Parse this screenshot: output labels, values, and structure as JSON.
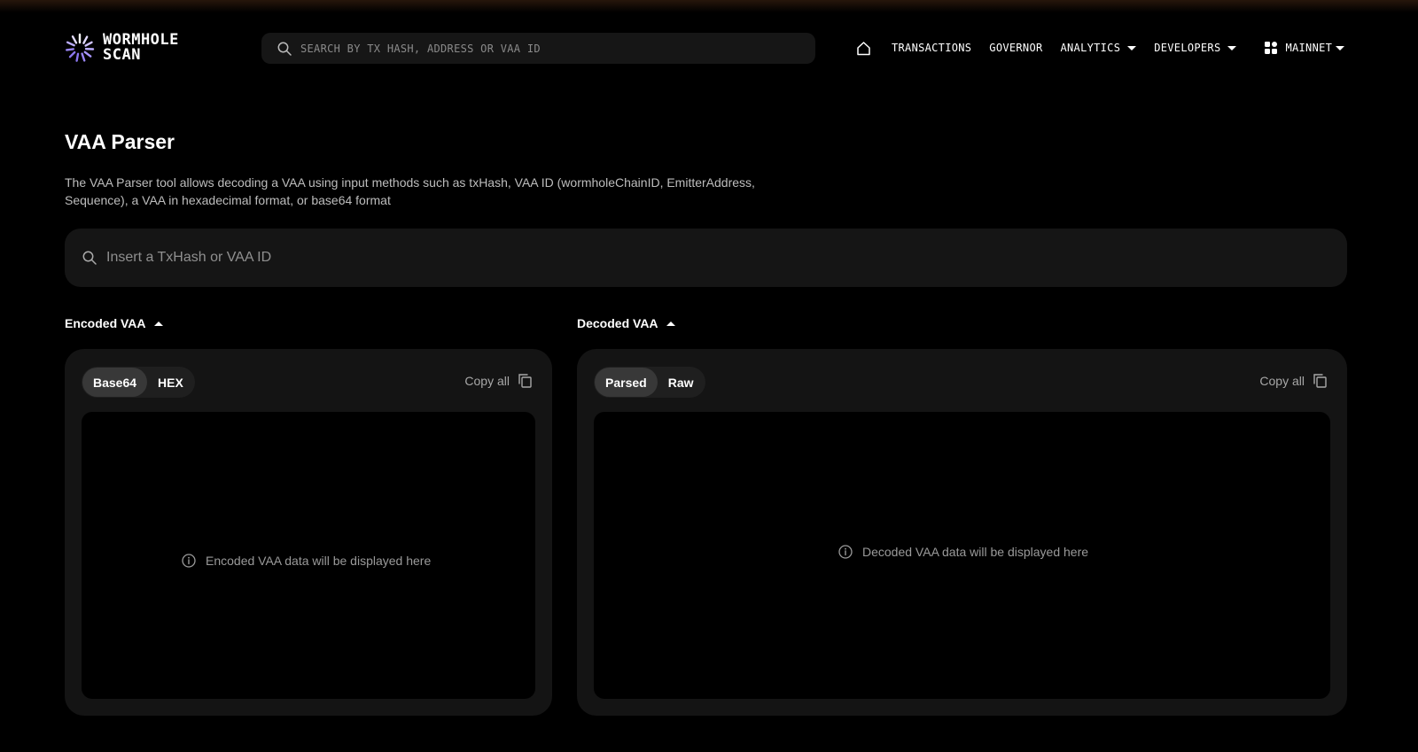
{
  "brand": {
    "line1": "WORMHOLE",
    "line2": "SCAN"
  },
  "top_search": {
    "placeholder": "SEARCH BY TX HASH, ADDRESS OR VAA ID"
  },
  "nav": {
    "items": [
      {
        "label": "TRANSACTIONS"
      },
      {
        "label": "GOVERNOR"
      },
      {
        "label": "ANALYTICS"
      },
      {
        "label": "DEVELOPERS"
      }
    ],
    "network": "MAINNET"
  },
  "page": {
    "title": "VAA Parser",
    "description_line1": "The VAA Parser tool allows decoding a VAA using input methods such as txHash, VAA ID (wormholeChainID, EmitterAddress,",
    "description_line2": "Sequence), a VAA in hexadecimal format, or base64 format"
  },
  "vaa_search": {
    "placeholder": "Insert a TxHash or VAA ID"
  },
  "encoded": {
    "label": "Encoded VAA",
    "tabs": [
      "Base64",
      "HEX"
    ],
    "active_tab": "Base64",
    "copy_label": "Copy all",
    "empty_message": "Encoded VAA data will be displayed here"
  },
  "decoded": {
    "label": "Decoded VAA",
    "tabs": [
      "Parsed",
      "Raw"
    ],
    "active_tab": "Parsed",
    "copy_label": "Copy all",
    "empty_message": "Decoded VAA data will be displayed here"
  },
  "colors": {
    "background": "#000000",
    "panel": "#141414",
    "brand_accent": "#b9a8ff"
  }
}
